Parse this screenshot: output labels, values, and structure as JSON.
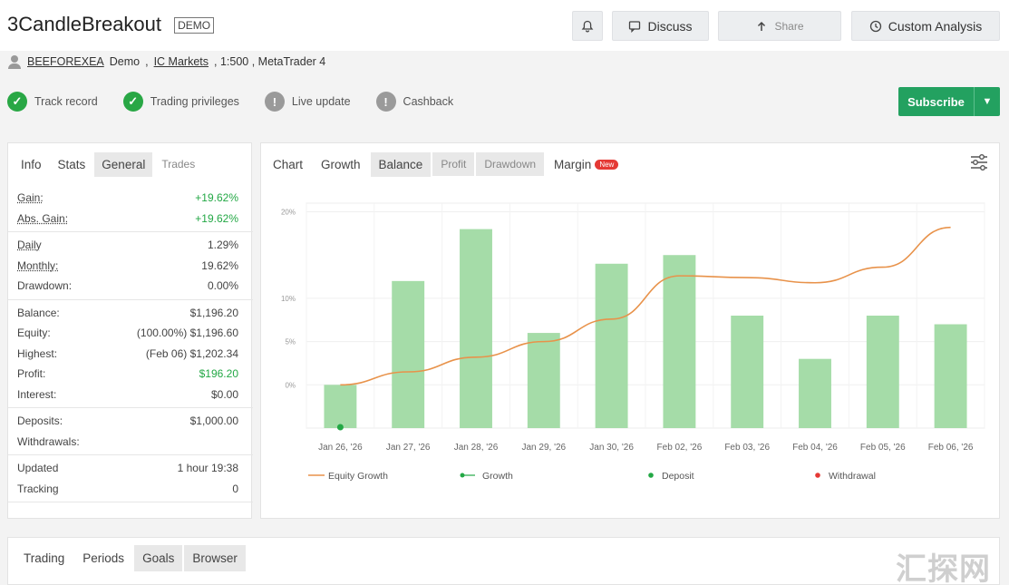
{
  "header": {
    "title": "3CandleBreakout",
    "title_badge": "DEMO",
    "notify_icon": "bell-icon",
    "discuss_label": "Discuss",
    "discuss_icon": "chat-icon",
    "share_label": "Share",
    "share_icon": "share-icon",
    "custom_label": "Custom Analysis",
    "custom_icon": "clock-icon"
  },
  "account": {
    "user_icon": "user-icon",
    "owner": "BEEFOREXEA",
    "type": "Demo",
    "broker": "IC Markets",
    "details": ", 1:500 , MetaTrader 4"
  },
  "badges": [
    {
      "label": "Track record",
      "status": "ok"
    },
    {
      "label": "Trading privileges",
      "status": "ok"
    },
    {
      "label": "Live update",
      "status": "warn"
    },
    {
      "label": "Cashback",
      "status": "warn"
    }
  ],
  "subscribe": {
    "label": "Subscribe"
  },
  "stats_tabs": [
    "Info",
    "Stats",
    "General",
    "Trades"
  ],
  "stats": {
    "groups": [
      [
        {
          "k": "Gain:",
          "v": "+19.62%",
          "green": true,
          "u": true
        },
        {
          "k": "Abs. Gain:",
          "v": "+19.62%",
          "green": true,
          "u": true
        }
      ],
      [
        {
          "k": "Daily",
          "v": "1.29%",
          "u": true
        },
        {
          "k": "Monthly:",
          "v": "19.62%",
          "u": true
        },
        {
          "k": "Drawdown:",
          "v": "0.00%"
        }
      ],
      [
        {
          "k": "Balance:",
          "v": "$1,196.20"
        },
        {
          "k": "Equity:",
          "v": "(100.00%) $1,196.60"
        },
        {
          "k": "Highest:",
          "v": "(Feb 06) $1,202.34"
        },
        {
          "k": "Profit:",
          "v": "$196.20",
          "green": true
        },
        {
          "k": "Interest:",
          "v": "$0.00"
        }
      ],
      [
        {
          "k": "Deposits:",
          "v": "$1,000.00"
        },
        {
          "k": "Withdrawals:",
          "v": ""
        }
      ],
      [
        {
          "k": "Updated",
          "v": "1 hour 19:38"
        },
        {
          "k": "Tracking",
          "v": "0"
        }
      ]
    ]
  },
  "chart_tabs": [
    "Chart",
    "Growth",
    "Balance",
    "Profit",
    "Drawdown",
    "Margin"
  ],
  "new_label": "New",
  "settings_icon": "sliders-icon",
  "chart_data": {
    "type": "bar",
    "categories": [
      "Jan 26, '26",
      "Jan 27, '26",
      "Jan 28, '26",
      "Jan 29, '26",
      "Jan 30, '26",
      "Feb 02, '26",
      "Feb 03, '26",
      "Feb 04, '26",
      "Feb 05, '26",
      "Feb 06, '26"
    ],
    "series": [
      {
        "name": "Growth",
        "kind": "bar",
        "color": "#a5dca8",
        "values": [
          0.0,
          12.0,
          18.0,
          6.0,
          14.0,
          15.0,
          8.0,
          3.0,
          8.0,
          7.0
        ]
      },
      {
        "name": "Equity Growth",
        "kind": "line",
        "color": "#e8924a",
        "values": [
          0.0,
          1.5,
          3.2,
          5.0,
          7.6,
          12.6,
          12.4,
          11.8,
          13.6,
          18.2
        ]
      }
    ],
    "deposit": {
      "category_index": 0,
      "value": 0,
      "color": "#23a845"
    },
    "yticks": [
      0,
      5,
      10,
      20
    ],
    "ytick_labels": [
      "0%",
      "5%",
      "10%",
      "20%"
    ],
    "ylim": [
      -5,
      21
    ],
    "legend": [
      {
        "label": "Equity Growth",
        "kind": "line",
        "color": "#e8924a"
      },
      {
        "label": "Growth",
        "kind": "dotline",
        "color": "#23a845"
      },
      {
        "label": "Deposit",
        "kind": "dot",
        "color": "#23a845"
      },
      {
        "label": "Withdrawal",
        "kind": "dot",
        "color": "#e53935"
      }
    ],
    "legend_position": "bottom",
    "grid": true
  },
  "bottom_tabs": [
    "Trading",
    "Periods",
    "Goals",
    "Browser"
  ],
  "watermark": "汇探网"
}
